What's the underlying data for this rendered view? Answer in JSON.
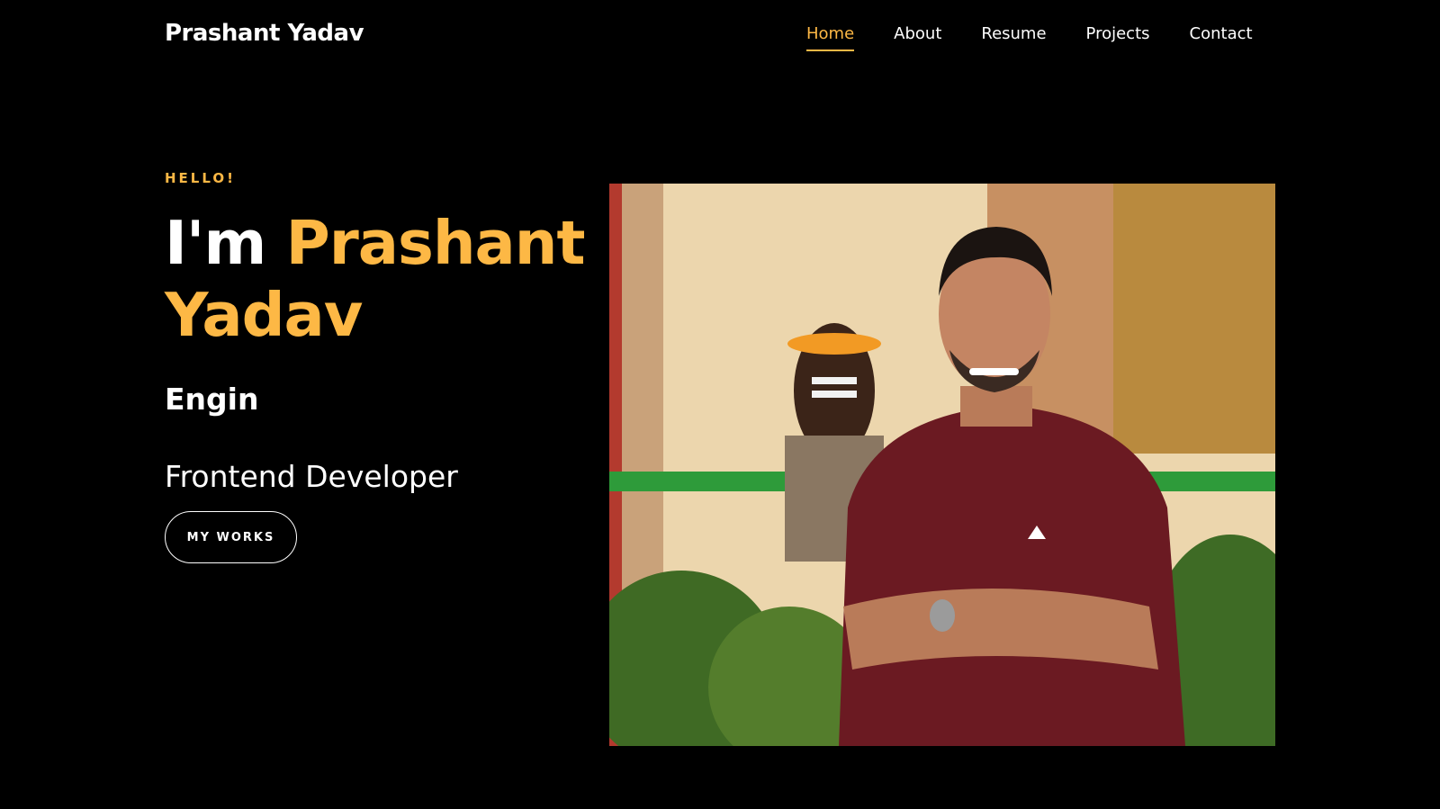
{
  "header": {
    "brand": "Prashant Yadav",
    "nav": [
      {
        "label": "Home",
        "active": true
      },
      {
        "label": "About",
        "active": false
      },
      {
        "label": "Resume",
        "active": false
      },
      {
        "label": "Projects",
        "active": false
      },
      {
        "label": "Contact",
        "active": false
      }
    ]
  },
  "hero": {
    "greeting": "HELLO!",
    "title_prefix": "I'm",
    "title_name": "Prashant Yadav",
    "typed_text": "Engin",
    "role": "Frontend Developer",
    "cta_label": "MY WORKS"
  },
  "photo": {
    "subject": "profile-photo"
  },
  "colors": {
    "background": "#000000",
    "accent": "#fdb845",
    "text": "#ffffff"
  }
}
